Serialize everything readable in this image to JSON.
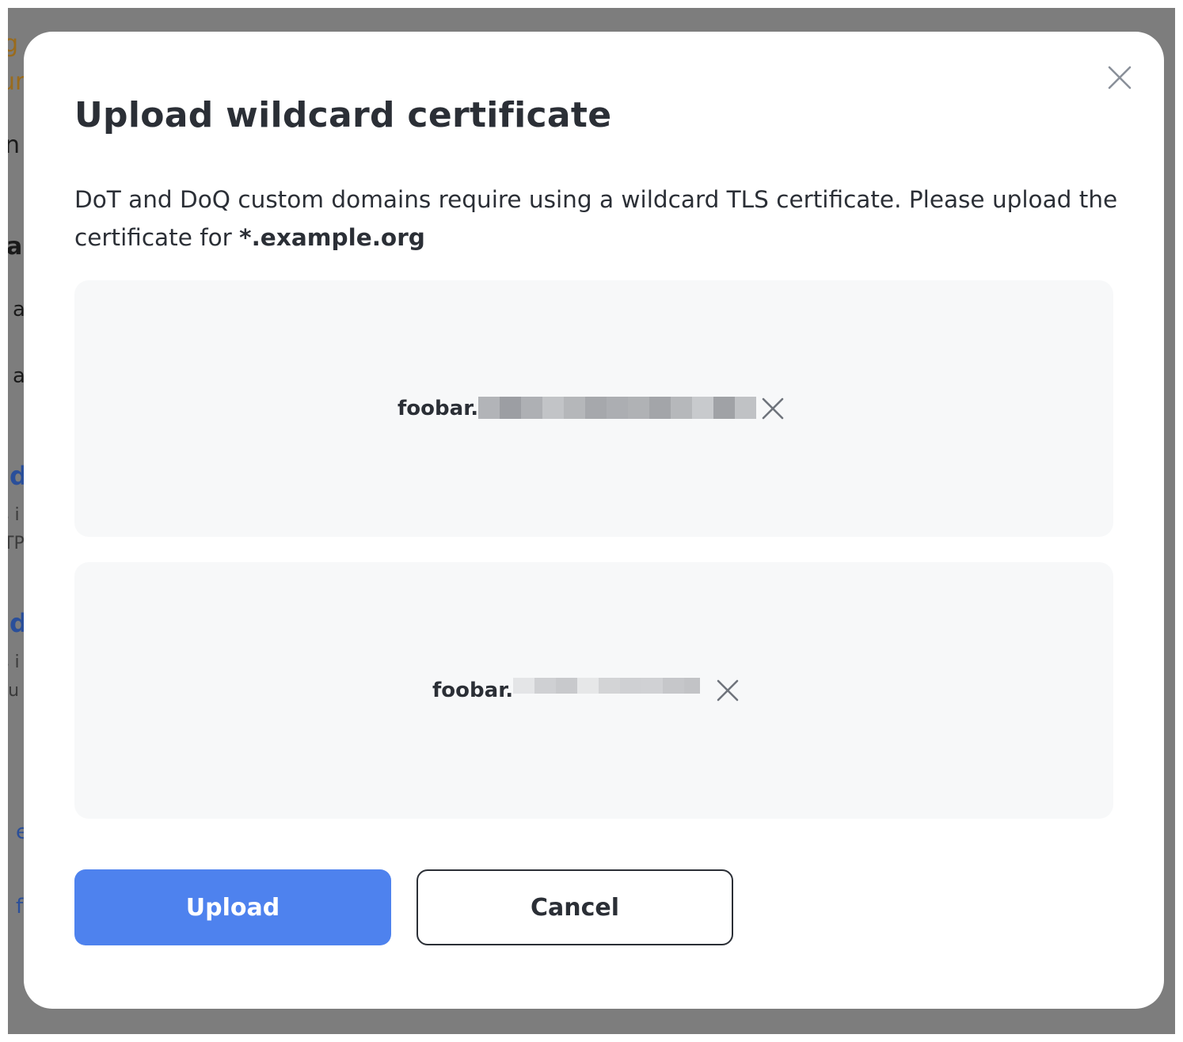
{
  "background": {
    "fragments": [
      "g",
      "ur",
      "n",
      "a",
      "a",
      "a",
      "d",
      "s i",
      "TP",
      "d",
      "s i",
      "lu",
      "e",
      "f"
    ]
  },
  "modal": {
    "title": "Upload wildcard certificate",
    "description_prefix": "DoT and DoQ custom domains require using a wildcard TLS certificate. Please upload the certificate for ",
    "domain": "*.example.org",
    "files": [
      {
        "name_visible": "foobar.",
        "redacted": true
      },
      {
        "name_visible": "foobar.",
        "redacted": true
      }
    ],
    "buttons": {
      "upload_label": "Upload",
      "cancel_label": "Cancel"
    },
    "icons": {
      "close": "close-icon",
      "remove": "close-icon"
    }
  },
  "colors": {
    "overlay": "#7d7d7d",
    "primary": "#4e82ee",
    "text": "#2b2f36",
    "file_box_bg": "#f7f8f9"
  }
}
